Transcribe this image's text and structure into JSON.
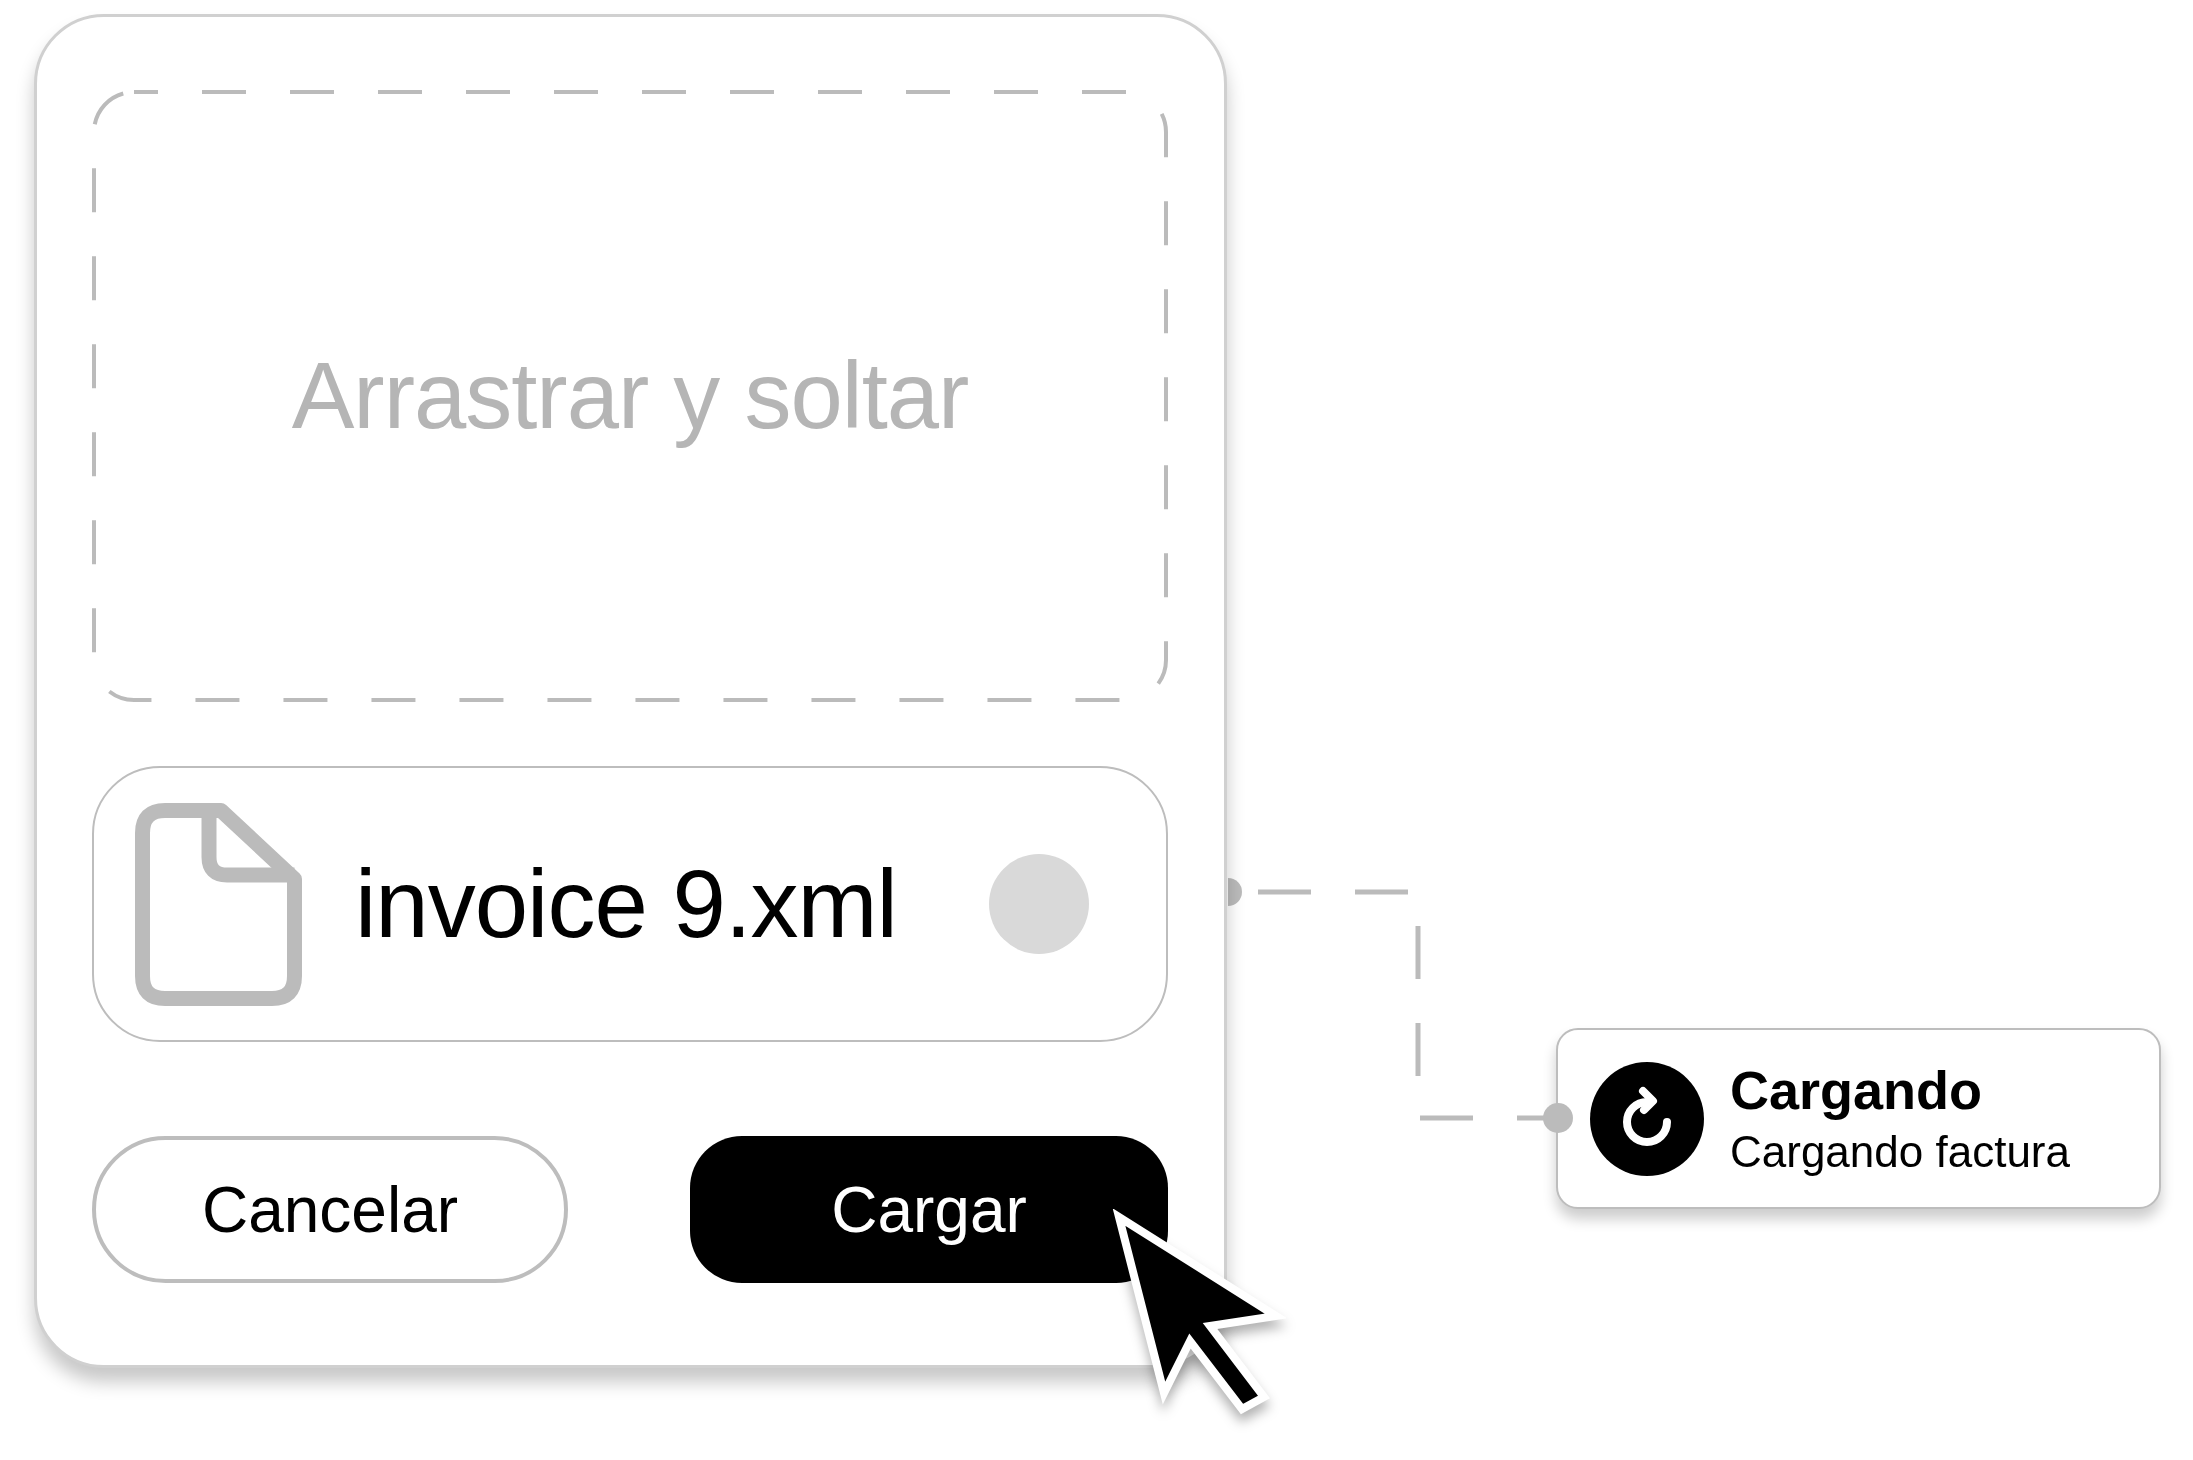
{
  "dropzone": {
    "label": "Arrastrar y soltar"
  },
  "file": {
    "name": "invoice 9.xml"
  },
  "buttons": [
    {
      "label": "Cancelar",
      "kind": "secondary"
    },
    {
      "label": "Cargar",
      "kind": "primary"
    }
  ],
  "status": {
    "title": "Cargando",
    "subtitle": "Cargando factura"
  }
}
